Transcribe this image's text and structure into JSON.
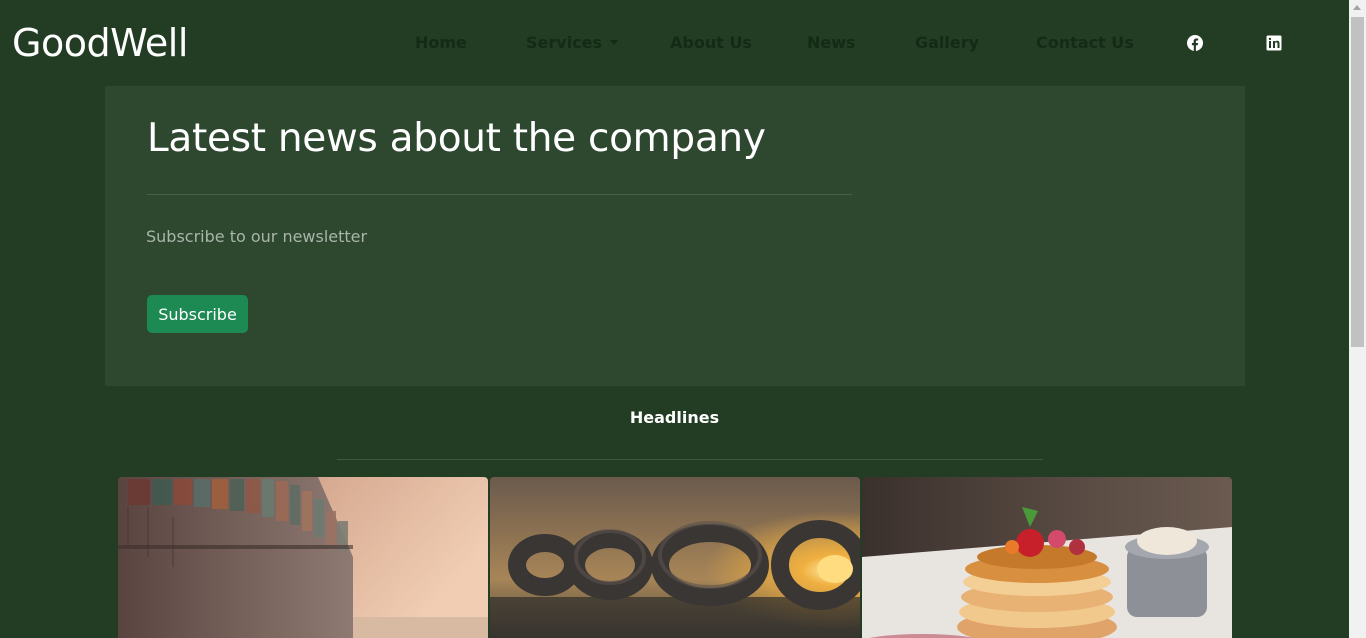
{
  "navbar": {
    "brand": "GoodWell",
    "links": [
      {
        "label": "Home"
      },
      {
        "label": "Services",
        "has_dropdown": true
      },
      {
        "label": "About Us"
      },
      {
        "label": "News"
      },
      {
        "label": "Gallery"
      },
      {
        "label": "Contact Us"
      }
    ],
    "social": [
      {
        "icon": "facebook-icon"
      },
      {
        "icon": "linkedin-icon"
      }
    ]
  },
  "hero": {
    "title": "Latest news about the company",
    "subtitle": "Subscribe to our newsletter",
    "button_label": "Subscribe"
  },
  "headlines": {
    "title": "Headlines",
    "cards": [
      {
        "image": "cargo-ship-image"
      },
      {
        "image": "chain-sunset-image"
      },
      {
        "image": "pancakes-image"
      }
    ]
  },
  "colors": {
    "background": "#223d23",
    "hero_background": "#2e4830",
    "button": "#1d8a54",
    "nav_text": "#142a16"
  }
}
